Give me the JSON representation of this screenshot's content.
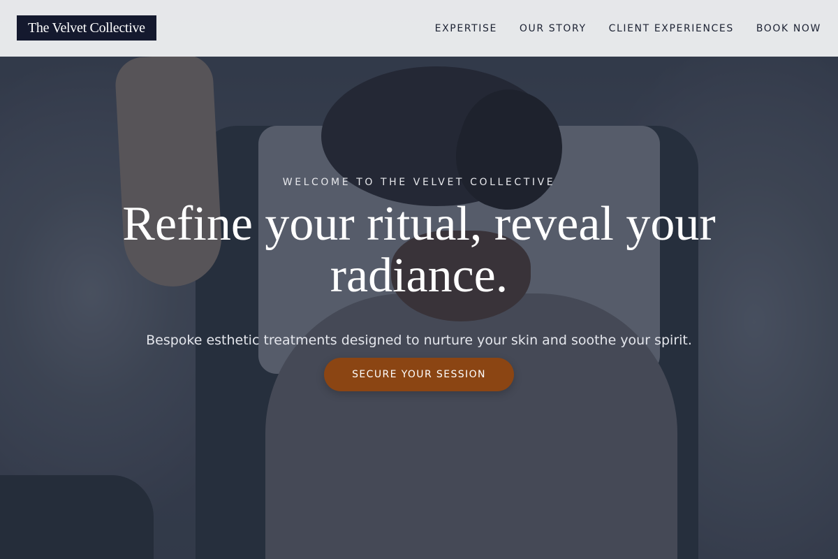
{
  "header": {
    "brand": "The Velvet Collective",
    "nav": [
      {
        "label": "EXPERTISE"
      },
      {
        "label": "OUR STORY"
      },
      {
        "label": "CLIENT EXPERIENCES"
      },
      {
        "label": "BOOK NOW"
      }
    ]
  },
  "hero": {
    "eyebrow": "WELCOME TO THE VELVET COLLECTIVE",
    "headline": "Refine your ritual, reveal your radiance.",
    "subtext": "Bespoke esthetic treatments designed to nurture your skin and soothe your spirit.",
    "cta_label": "SECURE YOUR SESSION"
  },
  "colors": {
    "brand_background": "#14192e",
    "cta": "#8b4513",
    "header_background": "#ecedef"
  }
}
